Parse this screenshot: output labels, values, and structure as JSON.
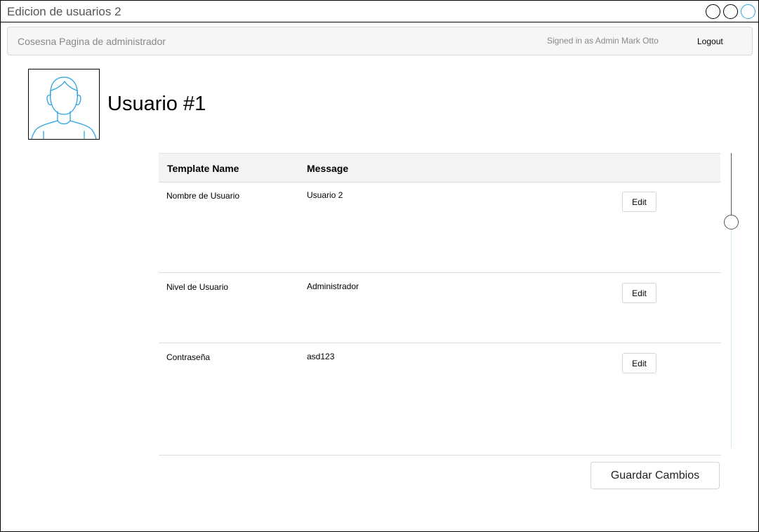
{
  "window": {
    "title": "Edicion de usuarios 2",
    "controls": [
      "circle-button",
      "circle-button",
      "circle-button"
    ]
  },
  "navbar": {
    "brand": "Cosesna Pagina de administrador",
    "signed_in": "Signed in as Admin Mark Otto",
    "logout_label": "Logout"
  },
  "profile": {
    "avatar_icon": "user-avatar-icon",
    "title": "Usuario #1"
  },
  "table": {
    "headers": [
      "Template Name",
      "Message"
    ],
    "rows": [
      {
        "name": "Nombre de Usuario",
        "message": "Usuario 2",
        "action": "Edit"
      },
      {
        "name": "Nivel de Usuario",
        "message": "Administrador",
        "action": "Edit"
      },
      {
        "name": "Contraseña",
        "message": "asd123",
        "action": "Edit"
      }
    ]
  },
  "save_label": "Guardar Cambios",
  "colors": {
    "accent": "#29a3e0",
    "border": "#dcdcdc",
    "navbar_bg": "#f6f6f6"
  }
}
